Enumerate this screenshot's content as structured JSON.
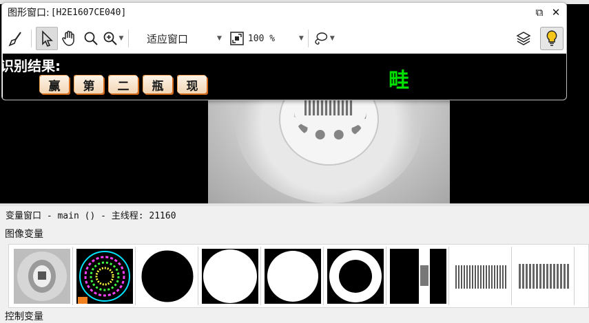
{
  "window": {
    "title_prefix": "图形窗口:",
    "title_id": "[H2E1607CE040]",
    "restore_glyph": "⧉",
    "close_glyph": "✕"
  },
  "toolbar": {
    "fit_label": "适应窗口",
    "zoom_value": "100 %",
    "tools": [
      "broom-icon",
      "pointer-icon",
      "hand-icon",
      "magnifier-icon",
      "zoom-in-icon",
      "fit-window-icon",
      "lasso-icon",
      "layers-icon",
      "lightbulb-icon"
    ]
  },
  "result": {
    "label": "识别结果:",
    "chars": [
      "赢",
      "第",
      "二",
      "瓶",
      "现"
    ],
    "green_text": "畦",
    "chip_color": "#f3d6b5",
    "green_color": "#00e000"
  },
  "status": {
    "text": "变量窗口 - main () - 主线程: 21160"
  },
  "sections": {
    "image_vars": "图像变量",
    "control_vars": "控制变量"
  },
  "thumbnails": [
    "bottle-photo",
    "colored-regions",
    "black-disc-outline",
    "white-disc",
    "white-disc-small",
    "white-ring",
    "black-with-white-bar",
    "barcode-strip-1",
    "barcode-strip-2"
  ]
}
